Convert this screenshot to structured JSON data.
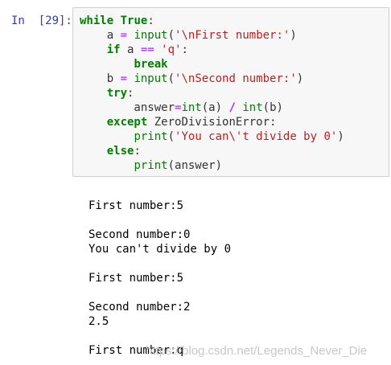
{
  "cell": {
    "prompt": "In  [29]:",
    "code_lines": [
      [
        {
          "t": "kw",
          "v": "while"
        },
        {
          "t": "p",
          "v": " "
        },
        {
          "t": "kw",
          "v": "True"
        },
        {
          "t": "p",
          "v": ":"
        }
      ],
      [
        {
          "t": "p",
          "v": "    a "
        },
        {
          "t": "opn",
          "v": "="
        },
        {
          "t": "p",
          "v": " "
        },
        {
          "t": "bi",
          "v": "input"
        },
        {
          "t": "p",
          "v": "("
        },
        {
          "t": "str",
          "v": "'\\nFirst number:'"
        },
        {
          "t": "p",
          "v": ")"
        }
      ],
      [
        {
          "t": "p",
          "v": "    "
        },
        {
          "t": "kw",
          "v": "if"
        },
        {
          "t": "p",
          "v": " a "
        },
        {
          "t": "opn",
          "v": "=="
        },
        {
          "t": "p",
          "v": " "
        },
        {
          "t": "str",
          "v": "'q'"
        },
        {
          "t": "p",
          "v": ":"
        }
      ],
      [
        {
          "t": "p",
          "v": "        "
        },
        {
          "t": "kw",
          "v": "break"
        }
      ],
      [
        {
          "t": "p",
          "v": "    b "
        },
        {
          "t": "opn",
          "v": "="
        },
        {
          "t": "p",
          "v": " "
        },
        {
          "t": "bi",
          "v": "input"
        },
        {
          "t": "p",
          "v": "("
        },
        {
          "t": "str",
          "v": "'\\nSecond number:'"
        },
        {
          "t": "p",
          "v": ")"
        }
      ],
      [
        {
          "t": "p",
          "v": "    "
        },
        {
          "t": "kw",
          "v": "try"
        },
        {
          "t": "p",
          "v": ":"
        }
      ],
      [
        {
          "t": "p",
          "v": "        answer"
        },
        {
          "t": "opn",
          "v": "="
        },
        {
          "t": "bi",
          "v": "int"
        },
        {
          "t": "p",
          "v": "(a) "
        },
        {
          "t": "op",
          "v": "/"
        },
        {
          "t": "p",
          "v": " "
        },
        {
          "t": "bi",
          "v": "int"
        },
        {
          "t": "p",
          "v": "(b)"
        }
      ],
      [
        {
          "t": "p",
          "v": "    "
        },
        {
          "t": "kw",
          "v": "except"
        },
        {
          "t": "p",
          "v": " ZeroDivisionError:"
        }
      ],
      [
        {
          "t": "p",
          "v": "        "
        },
        {
          "t": "bi",
          "v": "print"
        },
        {
          "t": "p",
          "v": "("
        },
        {
          "t": "str",
          "v": "'You can\\'t divide by 0'"
        },
        {
          "t": "p",
          "v": ")"
        }
      ],
      [
        {
          "t": "p",
          "v": "    "
        },
        {
          "t": "kw",
          "v": "else"
        },
        {
          "t": "p",
          "v": ":"
        }
      ],
      [
        {
          "t": "p",
          "v": "        "
        },
        {
          "t": "bi",
          "v": "print"
        },
        {
          "t": "p",
          "v": "(answer)"
        }
      ]
    ]
  },
  "output": {
    "lines": [
      "First number:5",
      "",
      "Second number:0",
      "You can't divide by 0",
      "",
      "First number:5",
      "",
      "Second number:2",
      "2.5",
      "",
      "First number:q"
    ]
  },
  "watermark": "https://blog.csdn.net/Legends_Never_Die",
  "colors": {
    "prompt": "#303f9f",
    "keyword": "#008000",
    "string": "#ba2121",
    "operator": "#aa22ff",
    "cell_background": "#f7f7f7",
    "cell_border": "#cfcfcf"
  }
}
